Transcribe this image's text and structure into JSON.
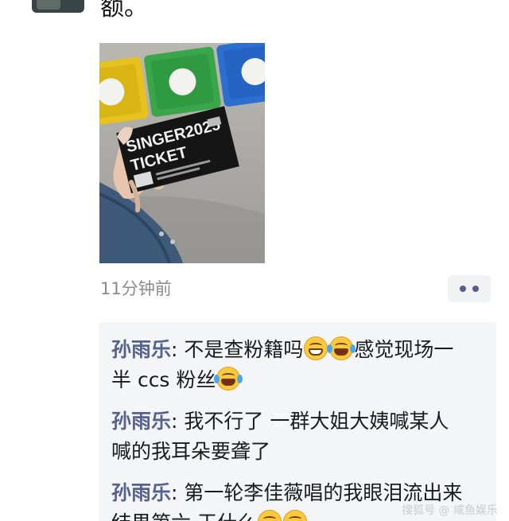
{
  "post": {
    "text": "额。",
    "timestamp": "11分钟前",
    "photo": {
      "ticket_line1": "SINGER2025",
      "ticket_line2": "TICKET"
    }
  },
  "comments": [
    {
      "author": "孙雨乐",
      "separator": ": ",
      "parts": [
        "不是查粉籍吗",
        "emoji:grin",
        "emoji:laugh-tears",
        "感觉现场一半 ccs 粉丝",
        "emoji:laugh-tears"
      ],
      "line1": "不是查粉籍吗",
      "line1_end": "感觉现场一",
      "line2": "半 ccs 粉丝"
    },
    {
      "author": "孙雨乐",
      "separator": ": ",
      "line1": "我不行了 一群大姐大姨喊某人",
      "line2": "喊的我耳朵要聋了"
    },
    {
      "author": "孙雨乐",
      "separator": ": ",
      "line1": "第一轮李佳薇唱的我眼泪流出来",
      "line2": "结果第六 干什么"
    }
  ],
  "watermark": "搜狐号 @ 咸鱼娱乐"
}
